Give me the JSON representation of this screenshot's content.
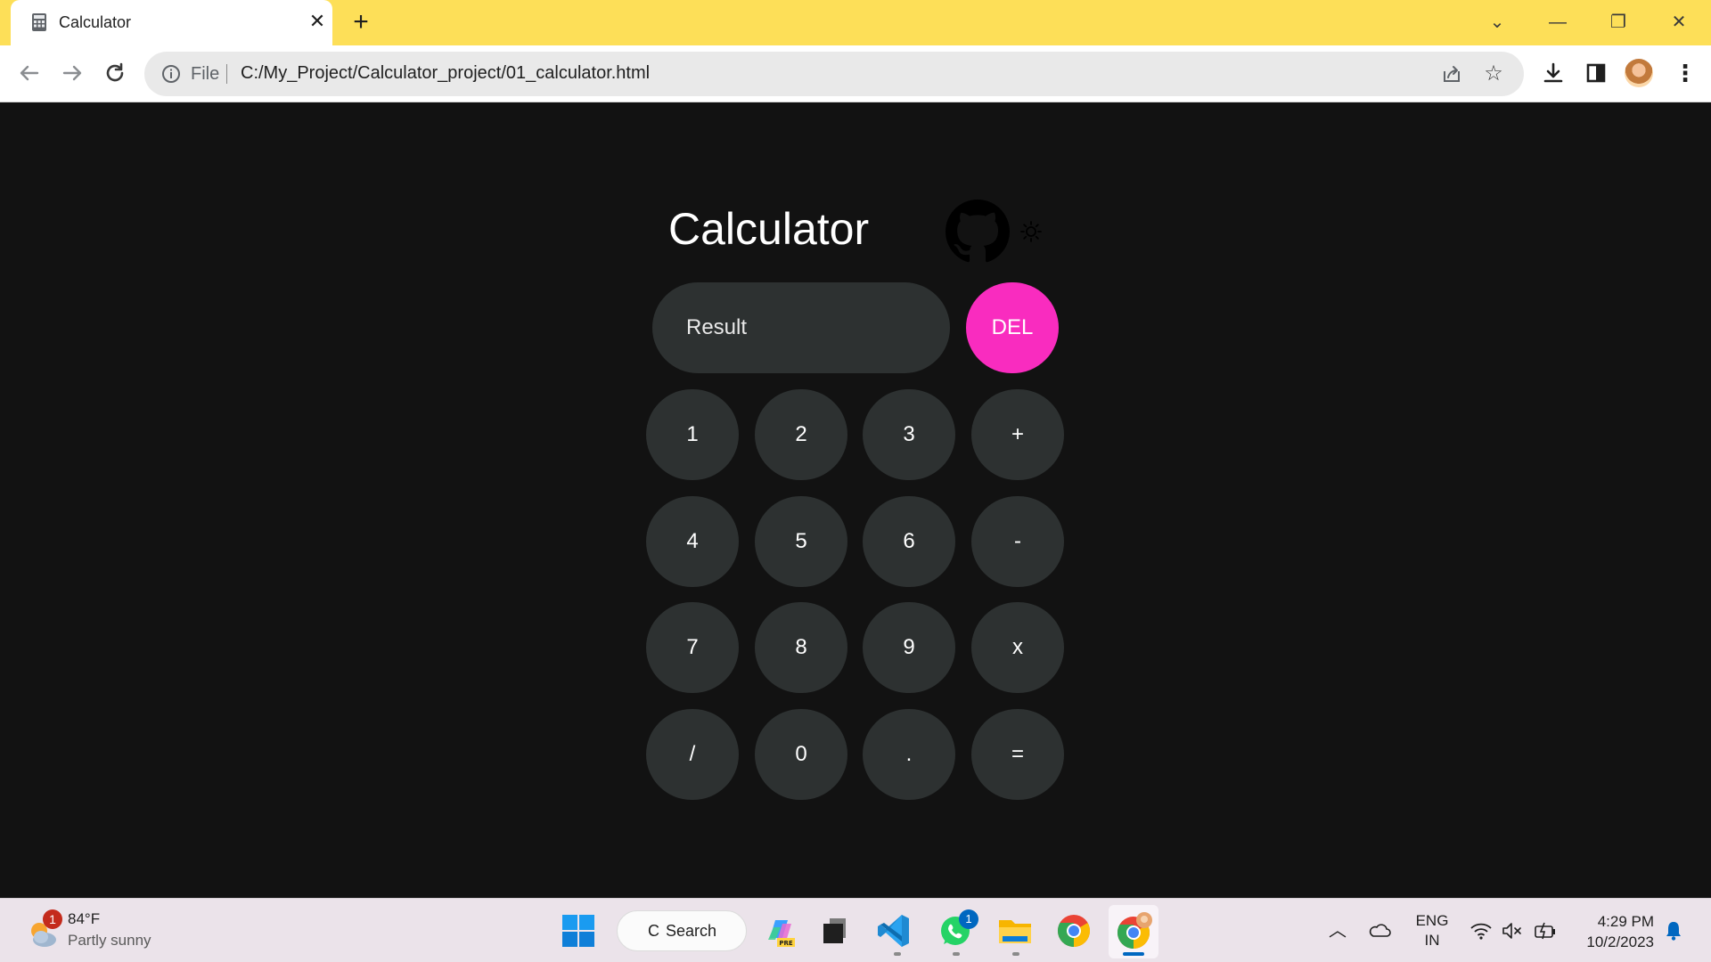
{
  "browser": {
    "tab_title": "Calculator",
    "tab_close": "✕",
    "new_tab": "+",
    "scheme": "File",
    "url": "C:/My_Project/Calculator_project/01_calculator.html",
    "window_controls": [
      "⌄",
      "—",
      "❐",
      "✕"
    ]
  },
  "app": {
    "title": "Calculator",
    "result_placeholder": "Result",
    "del_label": "DEL",
    "keys": [
      [
        "1",
        "2",
        "3",
        "+"
      ],
      [
        "4",
        "5",
        "6",
        "-"
      ],
      [
        "7",
        "8",
        "9",
        "x"
      ],
      [
        "/",
        "0",
        ".",
        "="
      ]
    ],
    "colors": {
      "background": "#121212",
      "key": "#2d3131",
      "accent": "#f92cbf"
    }
  },
  "taskbar": {
    "weather_badge": "1",
    "temperature": "84°F",
    "condition": "Partly sunny",
    "search_label": "Search",
    "whatsapp_badge": "1",
    "lang_top": "ENG",
    "lang_bottom": "IN",
    "time": "4:29 PM",
    "date": "10/2/2023"
  }
}
